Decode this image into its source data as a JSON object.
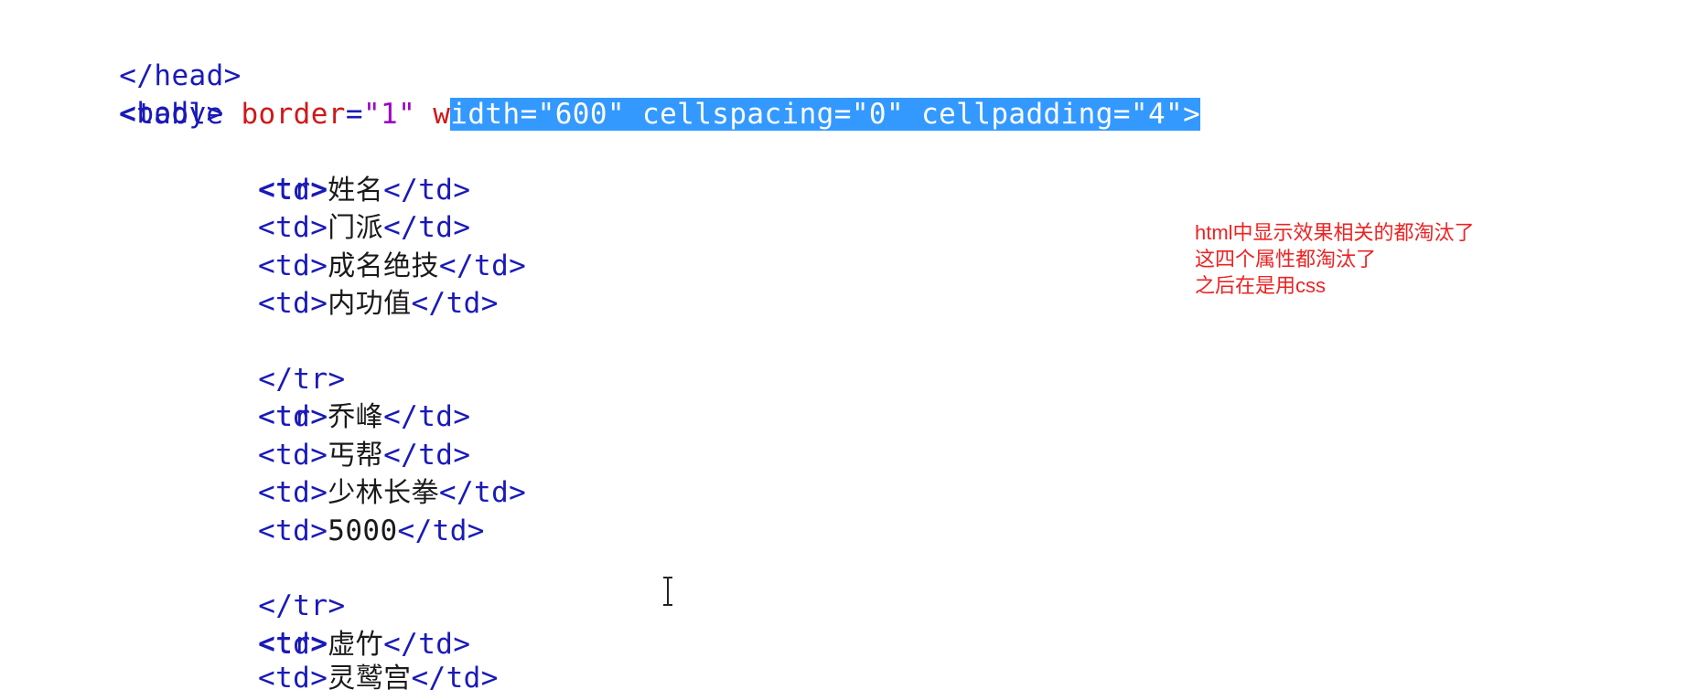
{
  "code": {
    "head_close": "</head>",
    "body_open": "<body>",
    "table_open": {
      "tag": "<table",
      "attr1": "border",
      "eq": "=",
      "val1": "\"1\"",
      "attr2_pre": "w",
      "selected": {
        "attr2_rest": "idth",
        "val2": "\"600\"",
        "attr3": "cellspacing",
        "val3": "\"0\"",
        "attr4": "cellpadding",
        "val4": "\"4\"",
        "close": ">"
      }
    },
    "tr_open": "<tr>",
    "tr_close": "</tr>",
    "td_open": "<td>",
    "td_close": "</td>",
    "cells": {
      "r1c1": "姓名",
      "r1c2": "门派",
      "r1c3": "成名绝技",
      "r1c4": "内功值",
      "r2c1": "乔峰",
      "r2c2": "丐帮",
      "r2c3": "少林长拳",
      "r2c4": "5000",
      "r3c1": "虚竹",
      "r3c2_partial": "灵鹫宫"
    }
  },
  "annotation": {
    "line1": "html中显示效果相关的都淘汰了",
    "line2": "这四个属性都淘汰了",
    "line3": "之后在是用css"
  },
  "cursor_icon": "text-cursor-icon",
  "colors": {
    "tag": "#1a1ab8",
    "attribute": "#d01818",
    "value": "#9a00c8",
    "selection": "#3399ff",
    "annotation": "#ee2222"
  }
}
